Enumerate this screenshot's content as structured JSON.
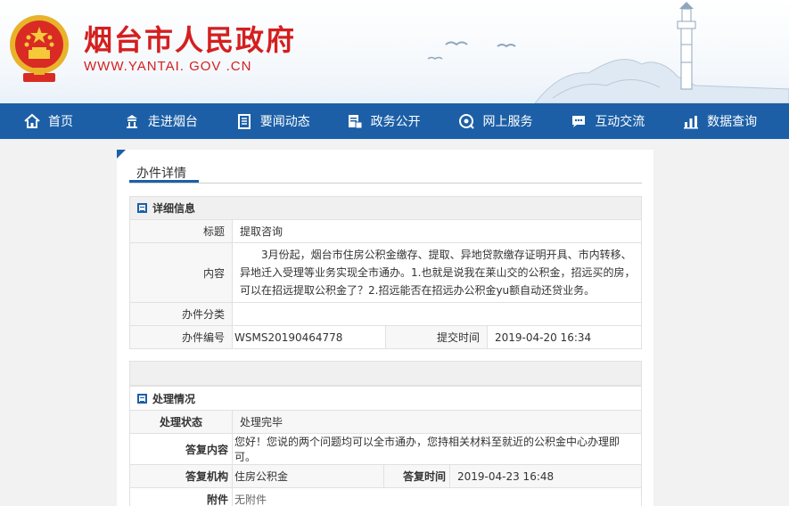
{
  "header": {
    "title": "烟台市人民政府",
    "url": "WWW.YANTAI. GOV .CN"
  },
  "nav": [
    {
      "label": "首页",
      "icon": "home-icon"
    },
    {
      "label": "走进烟台",
      "icon": "building-icon"
    },
    {
      "label": "要闻动态",
      "icon": "news-icon"
    },
    {
      "label": "政务公开",
      "icon": "document-icon"
    },
    {
      "label": "网上服务",
      "icon": "service-icon"
    },
    {
      "label": "互动交流",
      "icon": "chat-icon"
    },
    {
      "label": "数据查询",
      "icon": "chart-icon"
    }
  ],
  "panel": {
    "tab": "办件详情"
  },
  "detail": {
    "heading": "详细信息",
    "title_label": "标题",
    "title_value": "提取咨询",
    "content_label": "内容",
    "content_value": "3月份起，烟台市住房公积金缴存、提取、异地贷款缴存证明开具、市内转移、异地迁入受理等业务实现全市通办。1.也就是说我在莱山交的公积金，招远买的房，可以在招远提取公积金了？2.招远能否在招远办公积金yu额自动还贷业务。",
    "category_label": "办件分类",
    "category_value": "",
    "number_label": "办件编号",
    "number_value": "WSMS20190464778",
    "submit_label": "提交时间",
    "submit_value": "2019-04-20 16:34"
  },
  "process": {
    "heading": "处理情况",
    "status_label": "处理状态",
    "status_value": "处理完毕",
    "reply_label": "答复内容",
    "reply_value": "您好！您说的两个问题均可以全市通办，您持相关材料至就近的公积金中心办理即可。",
    "org_label": "答复机构",
    "org_value": "住房公积金",
    "reply_time_label": "答复时间",
    "reply_time_value": "2019-04-23 16:48",
    "attach_label": "附件",
    "attach_value": "无附件"
  },
  "colors": {
    "brand_red": "#d41f1f",
    "nav_blue": "#1c5fa6"
  }
}
